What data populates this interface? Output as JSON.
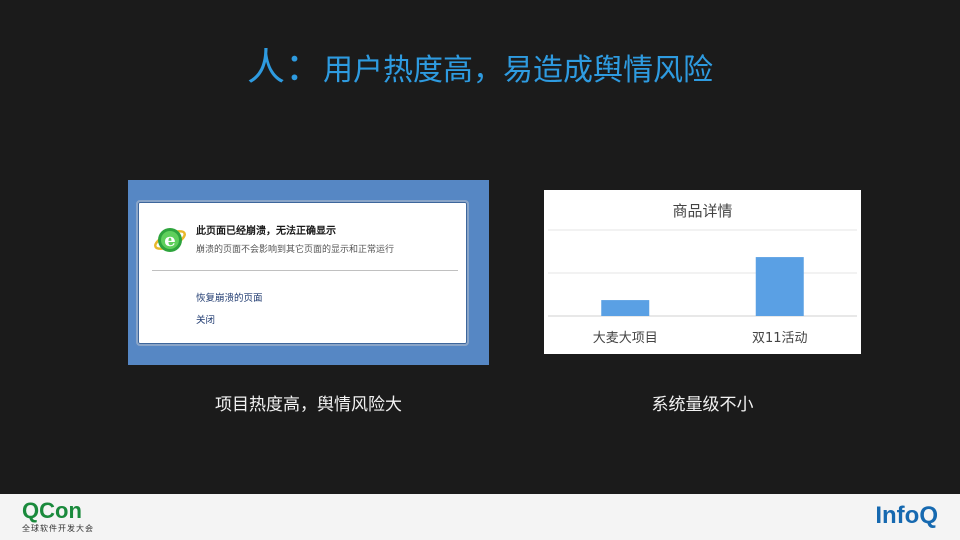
{
  "title": {
    "lead": "人：",
    "rest": "用户热度高，易造成舆情风险"
  },
  "left_panel": {
    "heading": "此页面已经崩溃，无法正确显示",
    "subtext": "崩溃的页面不会影响到其它页面的显示和正常运行",
    "restore_link": "恢复崩溃的页面",
    "close_link": "关闭",
    "caption": "项目热度高，舆情风险大",
    "colors": {
      "frame": "#5687c4",
      "link": "#1f3a70"
    },
    "icon": "ie-browser-icon"
  },
  "right_panel": {
    "caption": "系统量级不小",
    "chart_data": {
      "type": "bar",
      "title": "商品详情",
      "categories": [
        "大麦大项目",
        "双11活动"
      ],
      "values": [
        0.37,
        1.37
      ],
      "ylim": [
        0,
        2
      ],
      "grid": true,
      "bar_color": "#5aa0e4"
    }
  },
  "footer": {
    "qcon_name": "QCon",
    "qcon_sub": "全球软件开发大会",
    "infoq_name": "InfoQ",
    "qcon_color": "#1a8a3c",
    "infoq_color": "#1669b0"
  }
}
